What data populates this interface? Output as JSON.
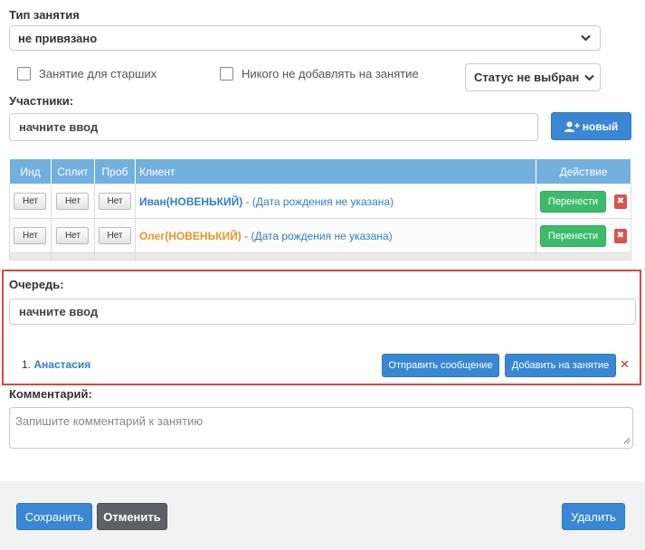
{
  "lesson_type": {
    "label": "Тип занятия",
    "value": "не привязано"
  },
  "options": {
    "seniors_checkbox": "Занятие для старших",
    "no_add_checkbox": "Никого не добавлять на занятие",
    "status_select": "Статус не выбран"
  },
  "participants": {
    "label": "Участники:",
    "search_value": "начните ввод",
    "new_button": "новый",
    "columns": [
      "Инд",
      "Сплит",
      "Проб",
      "Клиент",
      "Действие"
    ],
    "rows": [
      {
        "ind": "Нет",
        "split": "Нет",
        "prob": "Нет",
        "client_name": "Иван(НОВЕНЬКИЙ)",
        "client_info": "- (Дата рождения не указана)",
        "action": "Перенести",
        "name_color": "#2f7fc7"
      },
      {
        "ind": "Нет",
        "split": "Нет",
        "prob": "Нет",
        "client_name": "Олег(НОВЕНЬКИЙ)",
        "client_info": "- (Дата рождения не указана)",
        "action": "Перенести",
        "name_color": "#e79a2a"
      }
    ]
  },
  "queue": {
    "label": "Очередь:",
    "search_value": "начните ввод",
    "items": [
      {
        "number": "1.",
        "name": "Анастасия",
        "send_message": "Отправить сообщение",
        "add_to_lesson": "Добавить на занятие"
      }
    ],
    "highlight_color": "#d9473f"
  },
  "comment": {
    "label": "Комментарий:",
    "placeholder": "Запишите комментарий к занятию"
  },
  "footer": {
    "save": "Сохранить",
    "cancel": "Отменить",
    "delete": "Удалить"
  },
  "colors": {
    "primary": "#3a87d4",
    "success": "#3cbc6a",
    "danger": "#d9534f",
    "table_header": "#74b0dd"
  }
}
